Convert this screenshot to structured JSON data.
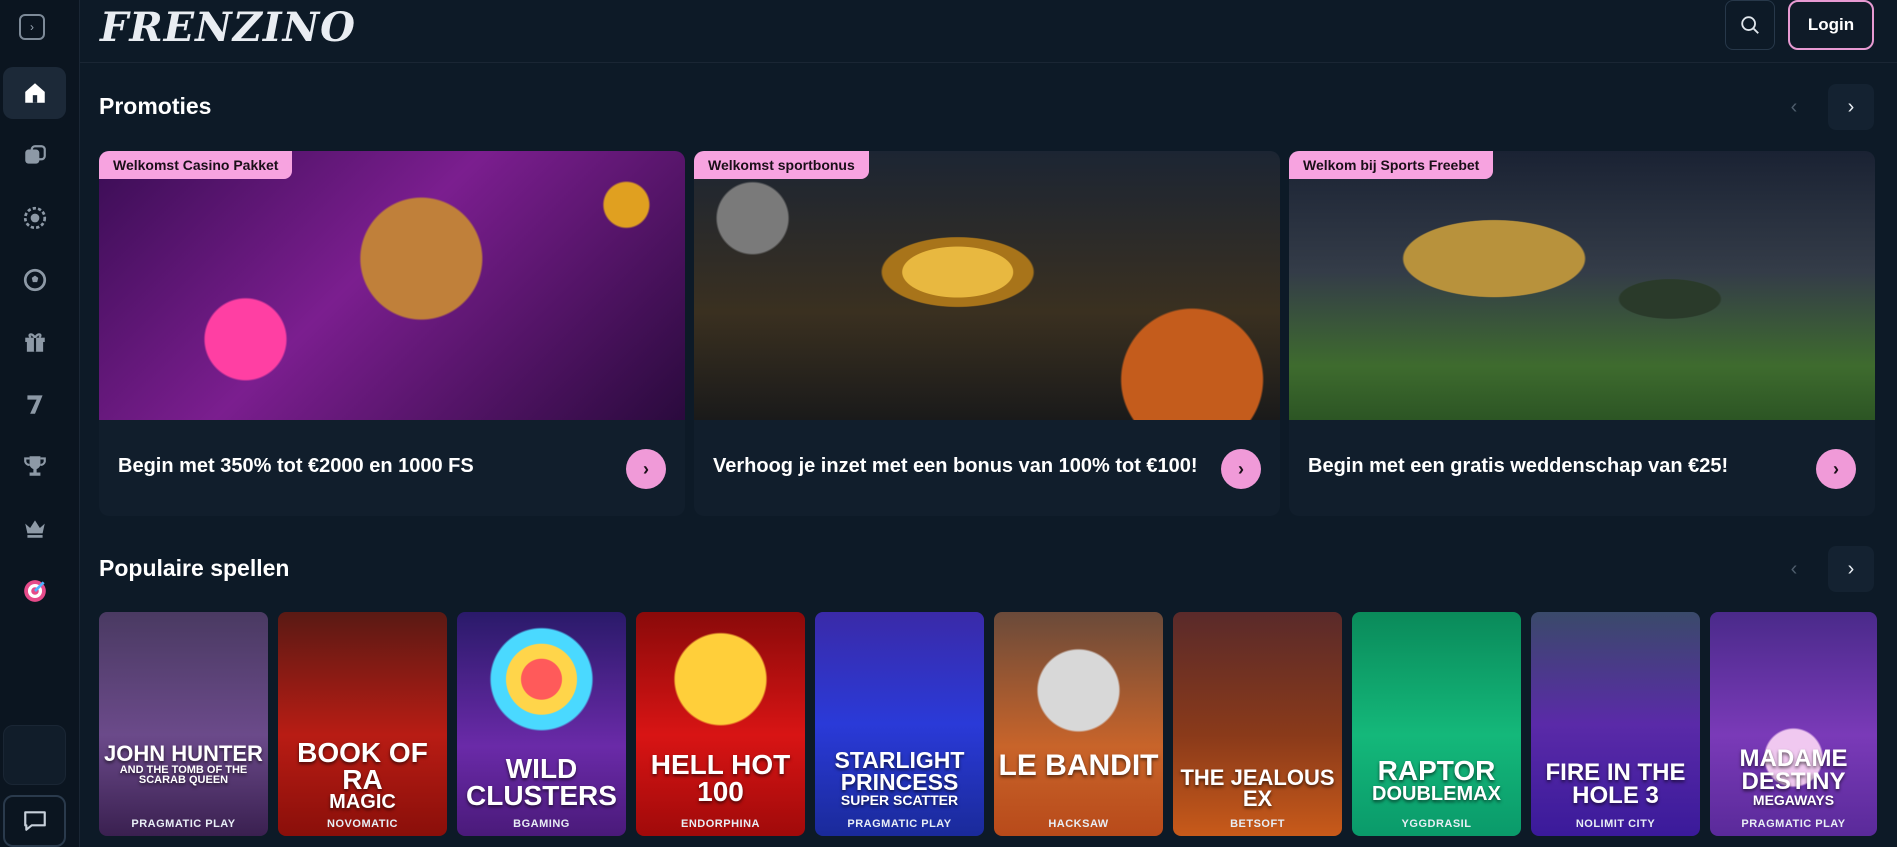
{
  "header": {
    "logo": "FRENZINO",
    "login_label": "Login"
  },
  "sidebar": {
    "items": [
      {
        "icon": "home-icon",
        "active": true
      },
      {
        "icon": "casino-chip-icon"
      },
      {
        "icon": "roulette-icon"
      },
      {
        "icon": "football-icon"
      },
      {
        "icon": "gift-icon"
      },
      {
        "icon": "seven-icon"
      },
      {
        "icon": "trophy-icon"
      },
      {
        "icon": "crown-icon"
      },
      {
        "icon": "target-icon"
      }
    ]
  },
  "promotions": {
    "title": "Promoties",
    "cards": [
      {
        "badge": "Welkomst Casino Pakket",
        "text": "Begin met 350% tot €2000 en 1000 FS"
      },
      {
        "badge": "Welkomst sportbonus",
        "text": "Verhoog je inzet met een bonus van 100% tot €100!"
      },
      {
        "badge": "Welkom bij Sports Freebet",
        "text": "Begin met een gratis weddenschap van €25!"
      }
    ]
  },
  "popular": {
    "title": "Populaire spellen",
    "games": [
      {
        "title": "John Hunter",
        "sub": "and the Tomb of the Scarab Queen",
        "provider": "PRAGMATIC PLAY"
      },
      {
        "title": "Book of Ra",
        "sub": "Magic",
        "provider": "NOVOMATIC"
      },
      {
        "title": "Wild Clusters",
        "sub": "",
        "provider": "BGAMING"
      },
      {
        "title": "Hell Hot 100",
        "sub": "",
        "provider": "ENDORPHINA"
      },
      {
        "title": "Starlight Princess",
        "sub": "Super Scatter",
        "provider": "PRAGMATIC PLAY"
      },
      {
        "title": "Le Bandit",
        "sub": "",
        "provider": "HACKSAW"
      },
      {
        "title": "The Jealous Ex",
        "sub": "",
        "provider": "BETSOFT"
      },
      {
        "title": "Raptor",
        "sub": "Doublemax",
        "provider": "YGGDRASIL"
      },
      {
        "title": "Fire in the Hole 3",
        "sub": "",
        "provider": "NOLIMIT CITY"
      },
      {
        "title": "Madame Destiny",
        "sub": "Megaways",
        "provider": "PRAGMATIC PLAY"
      }
    ]
  },
  "colors": {
    "accent_pink": "#f09ad8",
    "background": "#0d1a27"
  }
}
